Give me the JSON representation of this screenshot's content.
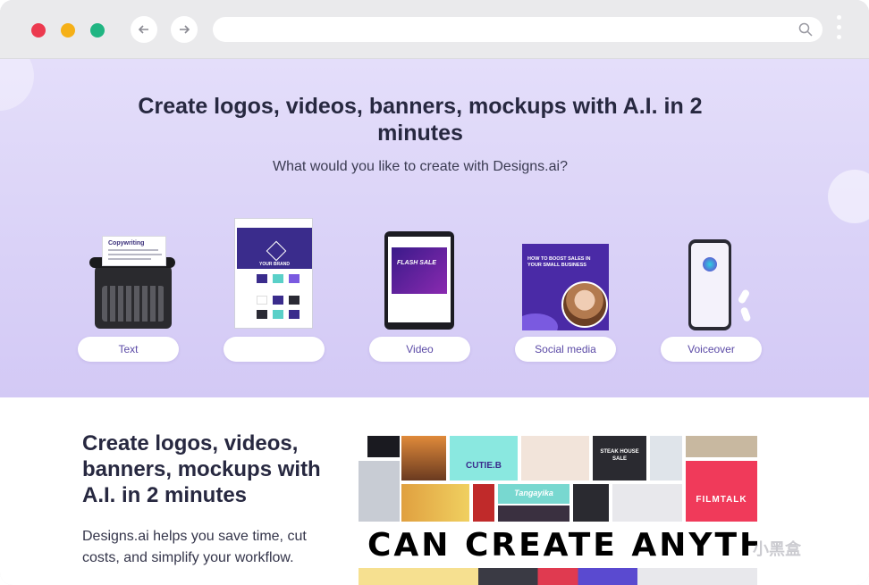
{
  "browser": {
    "back_icon": "arrow-left-icon",
    "forward_icon": "arrow-right-icon",
    "search_icon": "search-icon",
    "menu_icon": "kebab-menu-icon",
    "address_value": ""
  },
  "hero": {
    "title": "Create logos, videos, banners, mockups with A.I. in 2 minutes",
    "subtitle": "What would you like to create with Designs.ai?",
    "categories": [
      {
        "label": "Text"
      },
      {
        "label": ""
      },
      {
        "label": "Video"
      },
      {
        "label": "Social media"
      },
      {
        "label": "Voiceover"
      }
    ],
    "illustrations": {
      "typewriter_paper": "Copywriting",
      "brand_sheet": "YOUR BRAND",
      "tablet_video": "FLASH SALE",
      "social_post": "HOW TO BOOST SALES IN YOUR SMALL BUSINESS"
    }
  },
  "lower": {
    "title": "Create logos, videos, banners, mockups with A.I. in 2 minutes",
    "description": "Designs.ai helps you save time, cut costs, and simplify your workflow.",
    "mosaic": {
      "banner": "CAN CREATE ANYTH",
      "tile_cutie": "CUTIE.B",
      "tile_steak": "STEAK HOUSE SALE",
      "tile_film": "FILMTALK",
      "tile_script": "Tangayika"
    }
  },
  "watermark": "小黑盒",
  "colors": {
    "hero_bg": "#d9d1f7",
    "accent": "#3a2c8c",
    "text_dark": "#272840",
    "pill_text": "#5b4aa6"
  }
}
